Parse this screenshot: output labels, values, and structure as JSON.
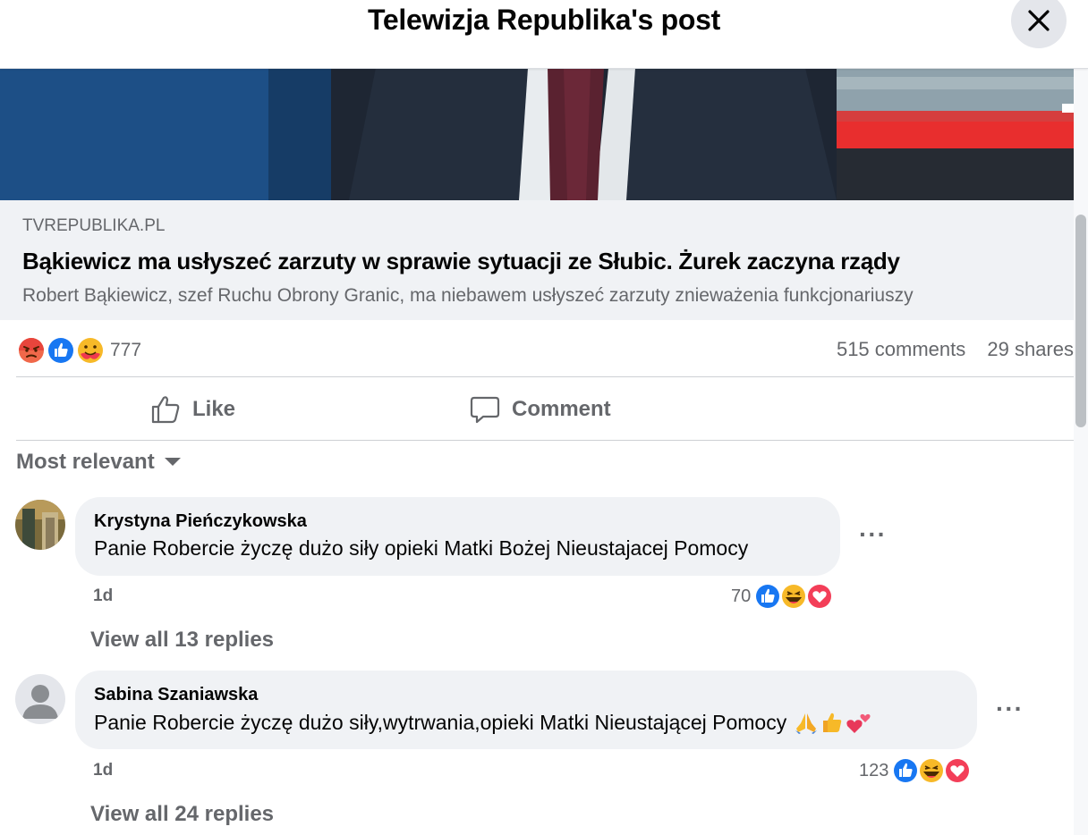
{
  "header": {
    "title": "Telewizja Republika's post"
  },
  "link_preview": {
    "domain": "TVREPUBLIKA.PL",
    "title": "Bąkiewicz ma usłyszeć zarzuty w sprawie sytuacji ze Słubic. Żurek zaczyna rządy",
    "description": "Robert Bąkiewicz, szef Ruchu Obrony Granic, ma niebawem usłyszeć zarzuty znieważenia funkcjonariuszy"
  },
  "post_stats": {
    "reaction_icons": [
      "angry-reaction-icon",
      "like-reaction-icon",
      "care-reaction-icon"
    ],
    "reaction_count": "777",
    "comments": "515 comments",
    "shares": "29 shares"
  },
  "actions": {
    "like": "Like",
    "comment": "Comment"
  },
  "sort": {
    "label": "Most relevant"
  },
  "comments": [
    {
      "author": "Krystyna Pieńczykowska",
      "text": "Panie Robercie życzę dużo siły opieki Matki Bożej Nieustajacej Pomocy",
      "time": "1d",
      "reaction_count": "70",
      "reaction_icons": [
        "like-reaction-icon",
        "haha-reaction-icon",
        "love-reaction-icon"
      ],
      "replies": "View all 13 replies"
    },
    {
      "author": "Sabina Szaniawska",
      "text": "Panie Robercie życzę dużo siły,wytrwania,opieki Matki Nieustającej Pomocy",
      "emojis": [
        "folded-hands-emoji",
        "thumbs-up-emoji",
        "two-hearts-emoji"
      ],
      "time": "1d",
      "reaction_count": "123",
      "reaction_icons": [
        "like-reaction-icon",
        "haha-reaction-icon",
        "love-reaction-icon"
      ],
      "replies": "View all 24 replies"
    }
  ],
  "colors": {
    "secondary_text": "#65676b",
    "bubble": "#f0f2f5",
    "like_blue": "#1877f2",
    "love_red": "#f33e58",
    "angry_orange": "#f0684a"
  }
}
